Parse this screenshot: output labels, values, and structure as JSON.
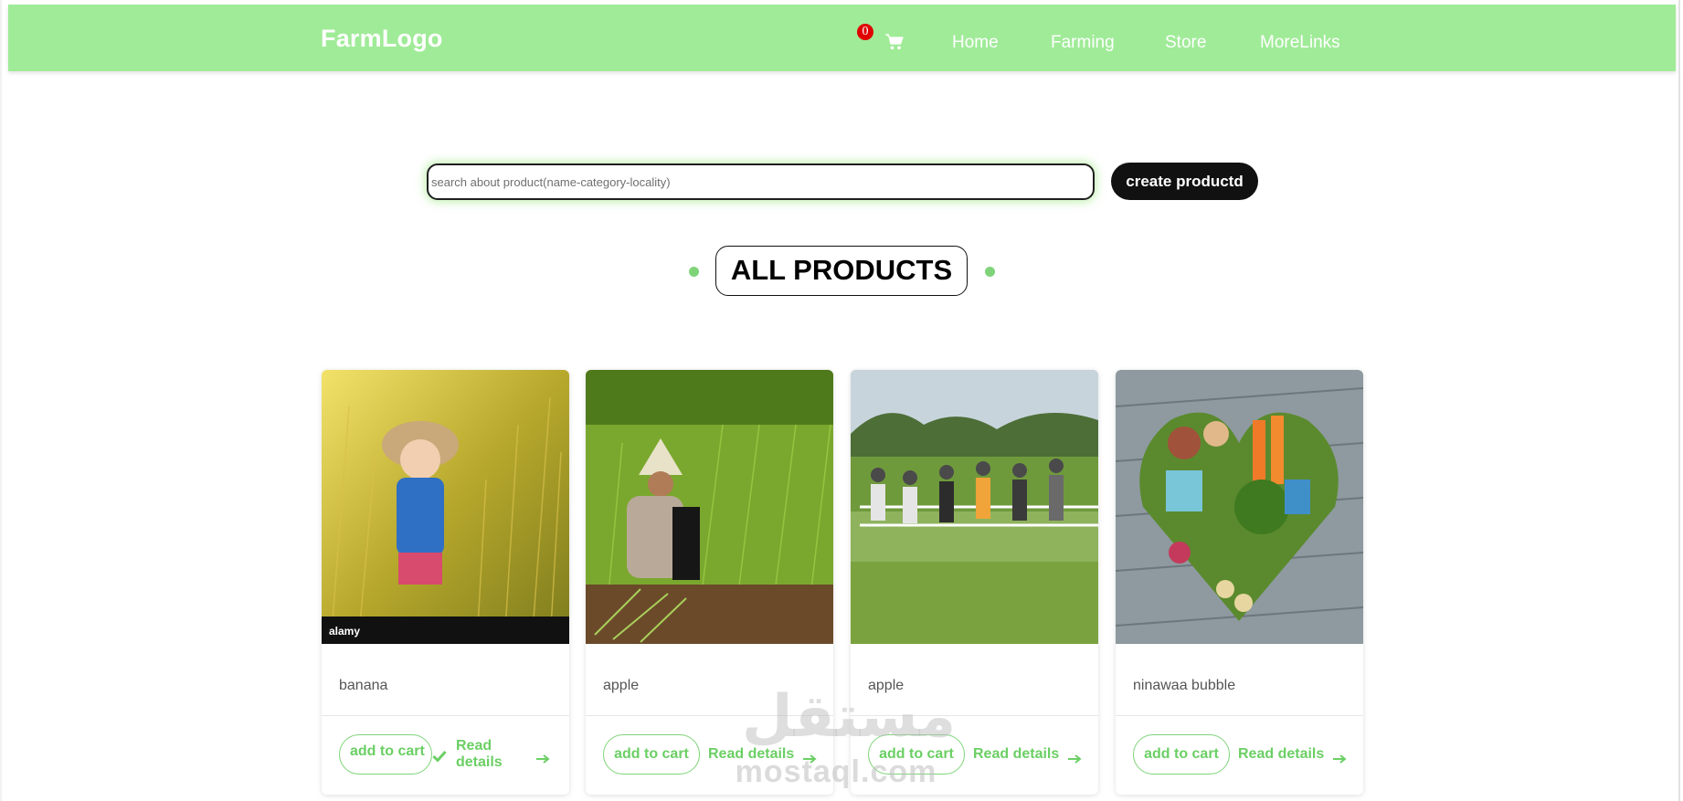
{
  "navbar": {
    "logo": "FarmLogo",
    "cart_count": "0",
    "links": [
      "Home",
      "Farming",
      "Store",
      "MoreLinks"
    ]
  },
  "search": {
    "placeholder": "search about product(name-category-locality)",
    "create_label": "create productd"
  },
  "section_title": "ALL PRODUCTS",
  "products": [
    {
      "name": "banana",
      "add_label": "add to cart",
      "details_label": "Read details",
      "image": "girl-in-rice-field-photo"
    },
    {
      "name": "apple",
      "add_label": "add to cart",
      "details_label": "Read details",
      "image": "farmer-harvesting-rice-photo"
    },
    {
      "name": "apple",
      "add_label": "add to cart",
      "details_label": "Read details",
      "image": "group-on-farm-field-photo"
    },
    {
      "name": "ninawaa bubble",
      "add_label": "add to cart",
      "details_label": "Read details",
      "image": "vegetable-heart-photo"
    }
  ],
  "watermark": {
    "arabic": "مستقل",
    "latin": "mostaql.com"
  },
  "colors": {
    "nav_bg": "#a0eb98",
    "accent": "#6bcf64",
    "badge": "#e00000"
  },
  "icons": {
    "cart": "shopping-cart-icon",
    "arrow": "arrow-right-icon",
    "check": "check-icon"
  }
}
